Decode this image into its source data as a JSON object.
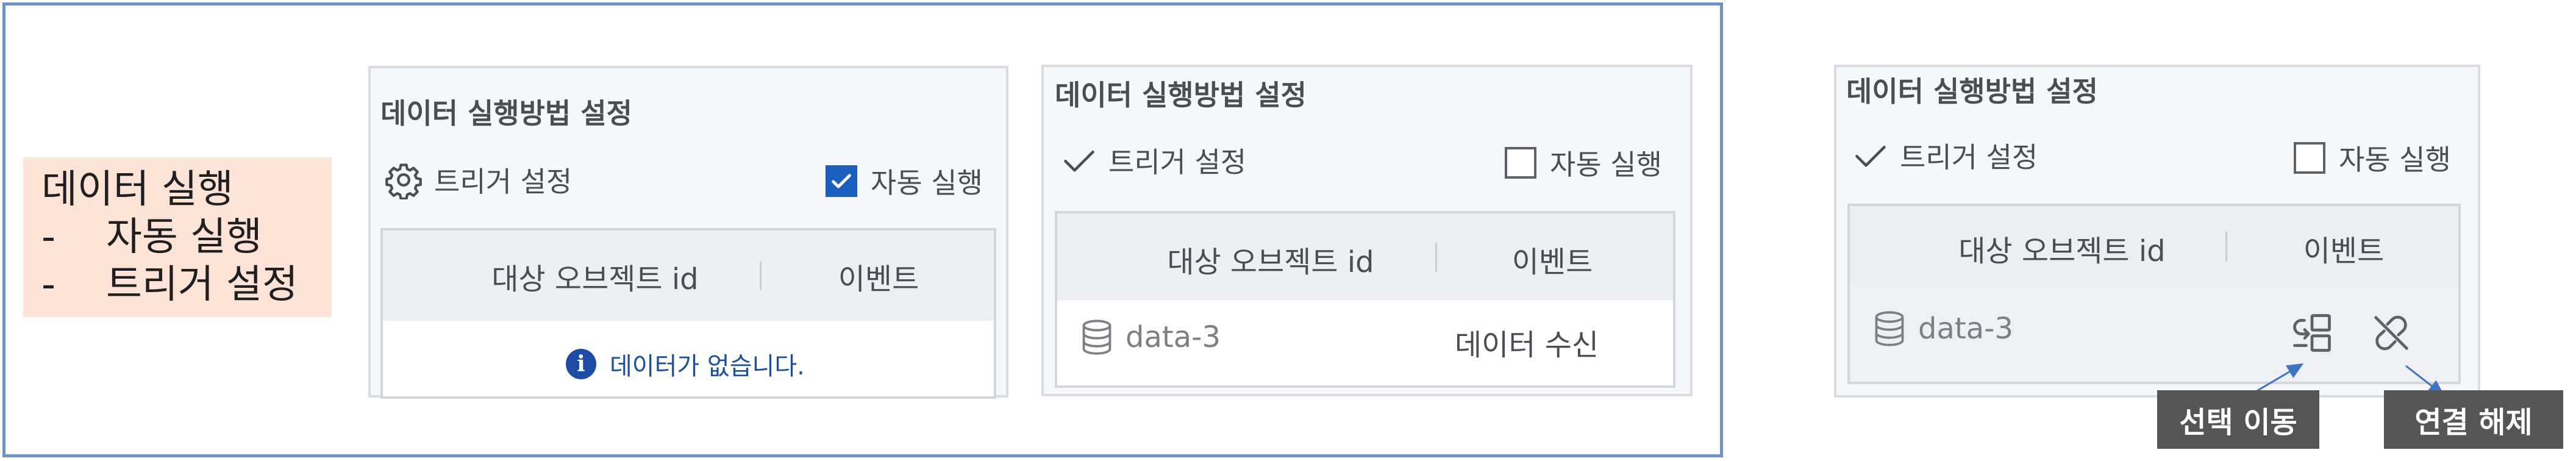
{
  "note": {
    "title": "데이터 실행",
    "items": [
      "자동 실행",
      "트리거 설정"
    ],
    "dash": "-"
  },
  "panel_a": {
    "title": "데이터 실행방법 설정",
    "trigger_label": "트리거 설정",
    "auto_label": "자동 실행",
    "auto_checked": true,
    "col_object": "대상 오브젝트 id",
    "col_event": "이벤트",
    "empty_message": "데이터가 없습니다.",
    "info_glyph": "i"
  },
  "panel_b": {
    "title": "데이터 실행방법 설정",
    "trigger_label": "트리거 설정",
    "auto_label": "자동 실행",
    "auto_checked": false,
    "col_object": "대상 오브젝트 id",
    "col_event": "이벤트",
    "rows": [
      {
        "object_id": "data-3",
        "event": "데이터 수신"
      }
    ]
  },
  "panel_c": {
    "title": "데이터 실행방법 설정",
    "trigger_label": "트리거 설정",
    "auto_label": "자동 실행",
    "auto_checked": false,
    "col_object": "대상 오브젝트 id",
    "col_event": "이벤트",
    "rows": [
      {
        "object_id": "data-3"
      }
    ]
  },
  "callouts": {
    "move_selection": "선택 이동",
    "disconnect": "연결 해제"
  },
  "colors": {
    "frame": "#6b93cf",
    "note_bg": "#fbe3d5",
    "checkbox_checked": "#1a5fbe",
    "info_text": "#1a4fa8",
    "callout_bg": "#555555",
    "arrow": "#3d74c4"
  },
  "icons": {
    "gear": "gear-icon",
    "check": "checkmark-icon",
    "database": "database-icon",
    "move": "move-selection-icon",
    "unlink": "unlink-icon",
    "info": "info-icon"
  }
}
